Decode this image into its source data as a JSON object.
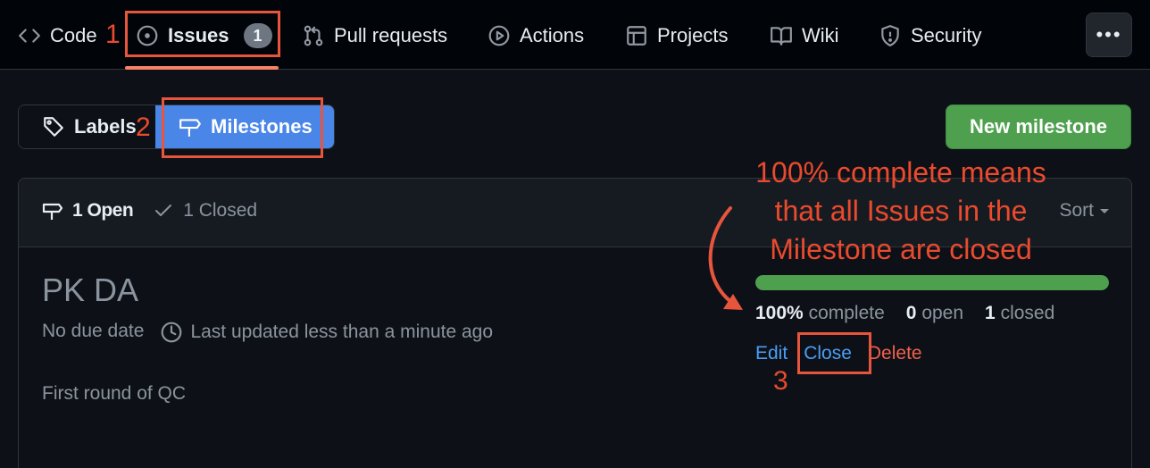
{
  "nav": {
    "tabs": [
      {
        "label": "Code",
        "icon": "code-icon"
      },
      {
        "label": "Issues",
        "icon": "issue-opened-icon",
        "counter": "1"
      },
      {
        "label": "Pull requests",
        "icon": "git-pull-request-icon"
      },
      {
        "label": "Actions",
        "icon": "play-icon"
      },
      {
        "label": "Projects",
        "icon": "table-icon"
      },
      {
        "label": "Wiki",
        "icon": "book-icon"
      },
      {
        "label": "Security",
        "icon": "shield-icon"
      }
    ],
    "more_icon": "kebab-horizontal-icon",
    "more_glyph": "•••",
    "active_tab": "Issues"
  },
  "segmented": {
    "labels": "Labels",
    "milestones": "Milestones",
    "active": "Milestones"
  },
  "new_milestone_label": "New milestone",
  "milestones_panel": {
    "open_state": "1 Open",
    "closed_state": "1 Closed",
    "sort_label": "Sort",
    "items": [
      {
        "title": "PK DA",
        "due": "No due date",
        "updated": "Last updated less than a minute ago",
        "description": "First round of QC",
        "progress_fraction": 1.0,
        "percent": "100%",
        "complete_word": "complete",
        "open_count": "0",
        "open_word": "open",
        "closed_count": "1",
        "closed_word": "closed",
        "actions": {
          "edit": "Edit",
          "close": "Close",
          "delete": "Delete"
        }
      }
    ]
  },
  "annotations": {
    "step1": "1",
    "step2": "2",
    "step3": "3",
    "note_lines": [
      "100% complete means",
      "that all Issues in the",
      "Milestone are closed"
    ],
    "color": "#ea4a2d"
  },
  "colors": {
    "background": "#0d1117",
    "accent_blue": "#4a86e8",
    "success_green": "#4ea04e",
    "danger_red": "#f0604c",
    "link_blue": "#4a9ef6"
  }
}
